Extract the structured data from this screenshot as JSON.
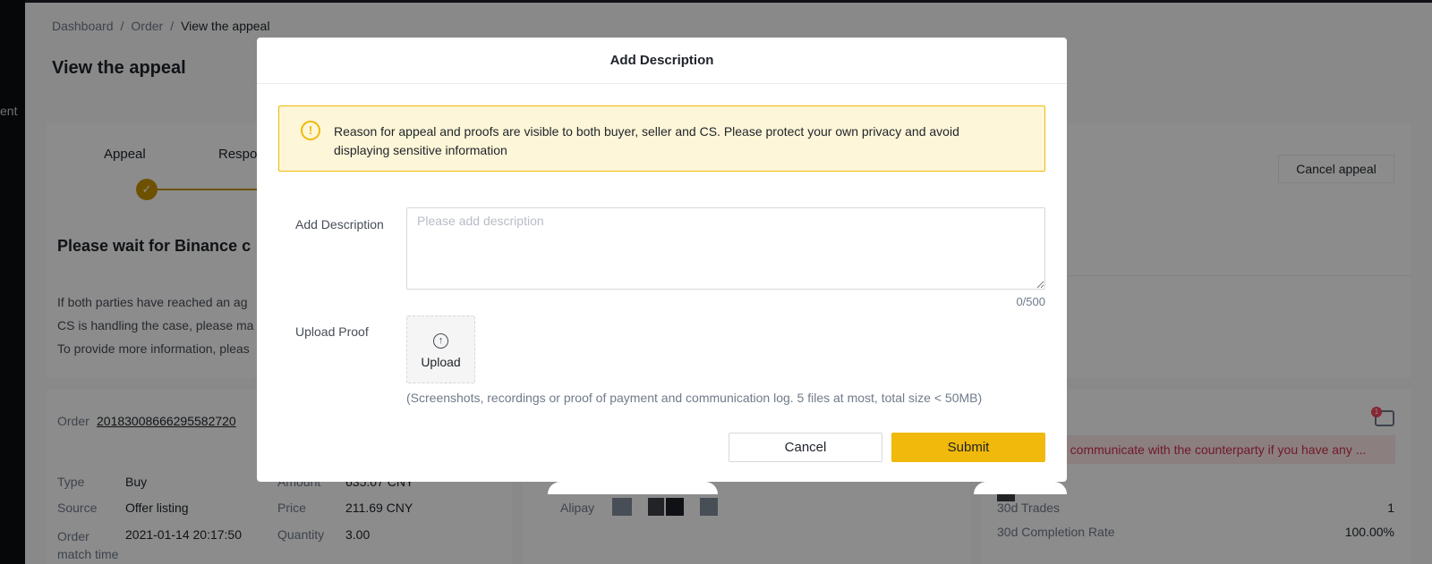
{
  "sidebar": {
    "partial_label": "ent"
  },
  "breadcrumb": {
    "items": [
      "Dashboard",
      "Order",
      "View the appeal"
    ]
  },
  "page": {
    "title": "View the appeal"
  },
  "steps": {
    "step1": "Appeal",
    "step2_partial": "Respo",
    "check": "✓"
  },
  "actions": {
    "cancel_appeal": "Cancel appeal"
  },
  "status": {
    "title_partial": "Please wait for Binance c",
    "line1_partial": "If both parties have reached an ag",
    "line2_partial": "CS is handling the case, please ma",
    "line3_partial": "To provide more information, pleas"
  },
  "order": {
    "label": "Order",
    "id": "20183008666295582720",
    "type_label": "Type",
    "type_value": "Buy",
    "source_label": "Source",
    "source_value": "Offer listing",
    "match_label": "Order match time",
    "match_value": "2021-01-14 20:17:50",
    "amount_label": "Amount",
    "amount_value": "635.07 CNY",
    "price_label": "Price",
    "price_value": "211.69 CNY",
    "quantity_label": "Quantity",
    "quantity_value": "3.00"
  },
  "payment": {
    "method": "Alipay"
  },
  "counterparty": {
    "warning_partial": "o communicate with the counterparty if you have any ...",
    "badge": "1",
    "trades_label": "30d Trades",
    "trades_value": "1",
    "completion_label": "30d Completion Rate",
    "completion_value": "100.00%"
  },
  "modal": {
    "title": "Add Description",
    "notice": "Reason for appeal and proofs are visible to both buyer, seller and CS. Please protect your own privacy and avoid displaying sensitive information",
    "notice_icon": "!",
    "description_label": "Add Description",
    "description_placeholder": "Please add description",
    "description_value": "",
    "char_count": "0/500",
    "upload_label": "Upload Proof",
    "upload_button": "Upload",
    "upload_icon": "↑",
    "upload_hint": "(Screenshots, recordings or proof of payment and communication log. 5 files at most, total size < 50MB)",
    "cancel": "Cancel",
    "submit": "Submit"
  },
  "colors": {
    "accent": "#f0b90b",
    "step_active": "#c99400",
    "warning_text": "#cf304a"
  }
}
